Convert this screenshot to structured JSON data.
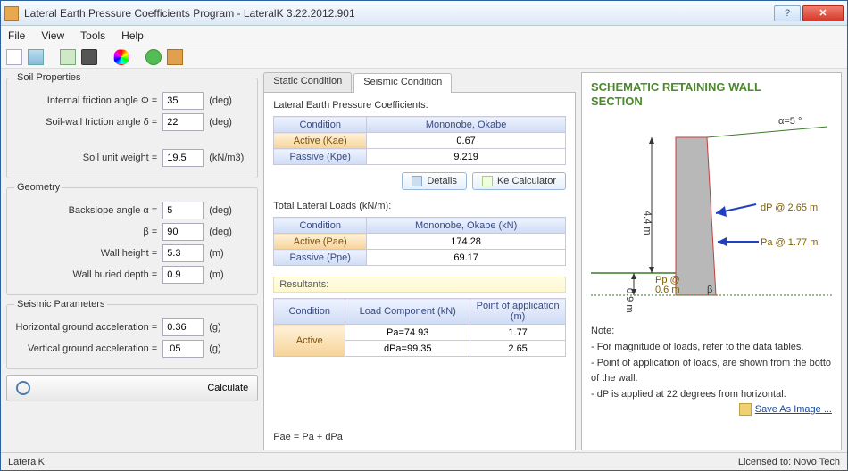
{
  "window": {
    "title": "Lateral Earth Pressure Coefficients Program - LateralK 3.22.2012.901"
  },
  "menu": {
    "file": "File",
    "view": "View",
    "tools": "Tools",
    "help": "Help"
  },
  "groups": {
    "soil": {
      "legend": "Soil Properties",
      "phi_label": "Internal friction angle  Φ =",
      "phi_val": "35",
      "phi_unit": "(deg)",
      "delta_label": "Soil-wall friction angle  δ =",
      "delta_val": "22",
      "delta_unit": "(deg)",
      "gamma_label": "Soil unit weight =",
      "gamma_val": "19.5",
      "gamma_unit": "(kN/m3)"
    },
    "geom": {
      "legend": "Geometry",
      "alpha_label": "Backslope angle  α =",
      "alpha_val": "5",
      "alpha_unit": "(deg)",
      "beta_label": "β =",
      "beta_val": "90",
      "beta_unit": "(deg)",
      "h_label": "Wall height =",
      "h_val": "5.3",
      "h_unit": "(m)",
      "bd_label": "Wall buried depth =",
      "bd_val": "0.9",
      "bd_unit": "(m)"
    },
    "seis": {
      "legend": "Seismic Parameters",
      "hga_label": "Horizontal ground acceleration =",
      "hga_val": "0.36",
      "hga_unit": "(g)",
      "vga_label": "Vertical ground acceleration =",
      "vga_val": ".05",
      "vga_unit": "(g)"
    },
    "calc": "Calculate"
  },
  "tabs": {
    "static": "Static Condition",
    "seismic": "Seismic Condition"
  },
  "mid": {
    "coeffs_lbl": "Lateral Earth Pressure Coefficients:",
    "cond_hdr": "Condition",
    "method_hdr": "Mononobe, Okabe",
    "kae_lbl": "Active (Kae)",
    "kae_val": "0.67",
    "kpe_lbl": "Passive (Kpe)",
    "kpe_val": "9.219",
    "details_btn": "Details",
    "kecalc_btn": "Ke Calculator",
    "loads_lbl": "Total Lateral Loads (kN/m):",
    "method_hdr2": "Mononobe, Okabe (kN)",
    "pae_lbl": "Active (Pae)",
    "pae_val": "174.28",
    "ppe_lbl": "Passive (Ppe)",
    "ppe_val": "69.17",
    "res_lbl": "Resultants:",
    "loadcomp_hdr": "Load Component (kN)",
    "poa_hdr": "Point of application (m)",
    "active_row": "Active",
    "pa_val": "Pa=74.93",
    "pa_poa": "1.77",
    "dpa_val": "dPa=99.35",
    "dpa_poa": "2.65",
    "formula": "Pae = Pa + dPa"
  },
  "schematic": {
    "title1": "SCHEMATIC RETAINING WALL",
    "title2": "SECTION",
    "alpha": "α=5   °",
    "h_main": "4.4 m",
    "h_bur": "0.9 m",
    "dP_lbl": "dP @ 2.65 m",
    "Pa_lbl": "Pa @ 1.77 m",
    "Pp_lbl": "Pp @",
    "Pp_lbl2": "0.6 m",
    "beta": "β",
    "note_h": "Note:",
    "note1": "- For magnitude of loads, refer to the data tables.",
    "note2": "- Point of application of loads, are shown from the botto",
    "note3": "of the wall.",
    "note4": "- dP is applied at 22 degrees from horizontal.",
    "save": "Save As Image ..."
  },
  "status": {
    "left": "LateralK",
    "right": "Licensed to: Novo Tech"
  }
}
